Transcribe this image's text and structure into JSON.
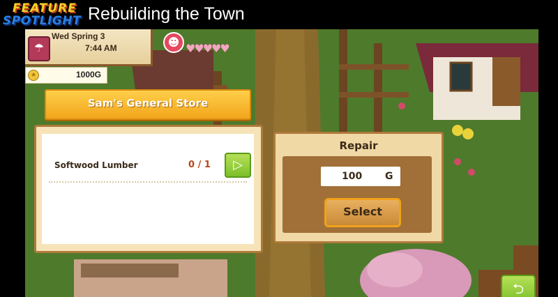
{
  "header": {
    "logo_line1": "FEATURE",
    "logo_line2": "SPOTLIGHT",
    "title": "Rebuilding the Town"
  },
  "hud": {
    "date": "Wed Spring 3",
    "time": "7:44 AM",
    "gold": "1000G",
    "weather_icon": "umbrella-icon",
    "mood_icon": "happy-face-icon",
    "hearts": "♥♥♥♥♥"
  },
  "store": {
    "name": "Sam's General Store",
    "items": [
      {
        "name": "Softwood Lumber",
        "count": "0 / 1"
      }
    ]
  },
  "repair": {
    "title": "Repair",
    "price": "100",
    "unit": "G",
    "select_label": "Select"
  },
  "colors": {
    "banner": "#f2a51c",
    "green_button": "#7cbf2a",
    "panel_border": "#b07a3a"
  }
}
